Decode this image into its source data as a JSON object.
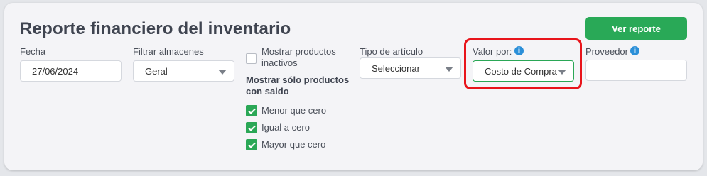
{
  "header": {
    "title": "Reporte financiero del inventario",
    "report_button": "Ver reporte"
  },
  "filters": {
    "date": {
      "label": "Fecha",
      "value": "27/06/2024"
    },
    "warehouses": {
      "label": "Filtrar almacenes",
      "value": "Geral"
    },
    "inactive": {
      "label_line1": "Mostrar productos",
      "label_line2": "inactivos",
      "checked": false
    },
    "balance": {
      "title_line1": "Mostrar sólo productos",
      "title_line2": "con saldo",
      "options": [
        {
          "label": "Menor que cero",
          "checked": true
        },
        {
          "label": "Igual a cero",
          "checked": true
        },
        {
          "label": "Mayor que cero",
          "checked": true
        }
      ]
    },
    "item_type": {
      "label": "Tipo de artículo",
      "value": "Seleccionar"
    },
    "value_by": {
      "label": "Valor por:",
      "value": "Costo de Compra",
      "info": "i"
    },
    "supplier": {
      "label": "Proveedor",
      "value": "",
      "info": "i"
    }
  },
  "colors": {
    "primary": "#29a957",
    "info": "#2b8fd8",
    "highlight": "#e8141b"
  }
}
